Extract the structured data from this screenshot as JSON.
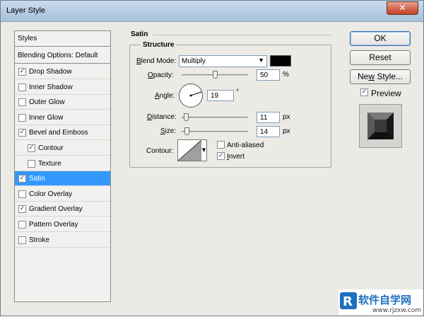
{
  "window": {
    "title": "Layer Style",
    "close_glyph": "✕"
  },
  "styles_panel": {
    "header": "Styles",
    "blending_options": "Blending Options: Default",
    "items": [
      {
        "label": "Drop Shadow",
        "checked": true,
        "indent": false,
        "selected": false
      },
      {
        "label": "Inner Shadow",
        "checked": false,
        "indent": false,
        "selected": false
      },
      {
        "label": "Outer Glow",
        "checked": false,
        "indent": false,
        "selected": false
      },
      {
        "label": "Inner Glow",
        "checked": false,
        "indent": false,
        "selected": false
      },
      {
        "label": "Bevel and Emboss",
        "checked": true,
        "indent": false,
        "selected": false
      },
      {
        "label": "Contour",
        "checked": true,
        "indent": true,
        "selected": false
      },
      {
        "label": "Texture",
        "checked": false,
        "indent": true,
        "selected": false
      },
      {
        "label": "Satin",
        "checked": true,
        "indent": false,
        "selected": true
      },
      {
        "label": "Color Overlay",
        "checked": false,
        "indent": false,
        "selected": false
      },
      {
        "label": "Gradient Overlay",
        "checked": true,
        "indent": false,
        "selected": false
      },
      {
        "label": "Pattern Overlay",
        "checked": false,
        "indent": false,
        "selected": false
      },
      {
        "label": "Stroke",
        "checked": false,
        "indent": false,
        "selected": false
      }
    ]
  },
  "satin": {
    "title": "Satin",
    "structure_title": "Structure",
    "blend_mode": {
      "label_prefix": "B",
      "label_rest": "lend Mode:",
      "value": "Multiply",
      "color": "#000000"
    },
    "opacity": {
      "label_prefix": "O",
      "label_rest": "pacity:",
      "value": "50",
      "unit": "%",
      "level_percent": 50
    },
    "angle": {
      "label_prefix": "A",
      "label_rest": "ngle:",
      "value": "19",
      "unit": "°"
    },
    "distance": {
      "label_prefix": "D",
      "label_rest": "istance:",
      "value": "11",
      "unit": "px"
    },
    "size": {
      "label_prefix": "S",
      "label_rest": "ize:",
      "value": "14",
      "unit": "px"
    },
    "contour": {
      "label": "Contour:"
    },
    "anti_aliased": {
      "label_prefix": "",
      "label_rest": "Anti-aliased",
      "checked": false
    },
    "invert": {
      "label_prefix": "I",
      "label_rest": "nvert",
      "checked": true
    }
  },
  "buttons": {
    "ok": "OK",
    "reset": "Reset",
    "new_style_prefix": "Ne",
    "new_style_underline": "w",
    "new_style_rest": " Style...",
    "preview_label": "Preview",
    "preview_checked": true
  },
  "watermark": {
    "brand": "软件自学网",
    "url": "www.rjzxw.com"
  },
  "check_glyph": "✓"
}
